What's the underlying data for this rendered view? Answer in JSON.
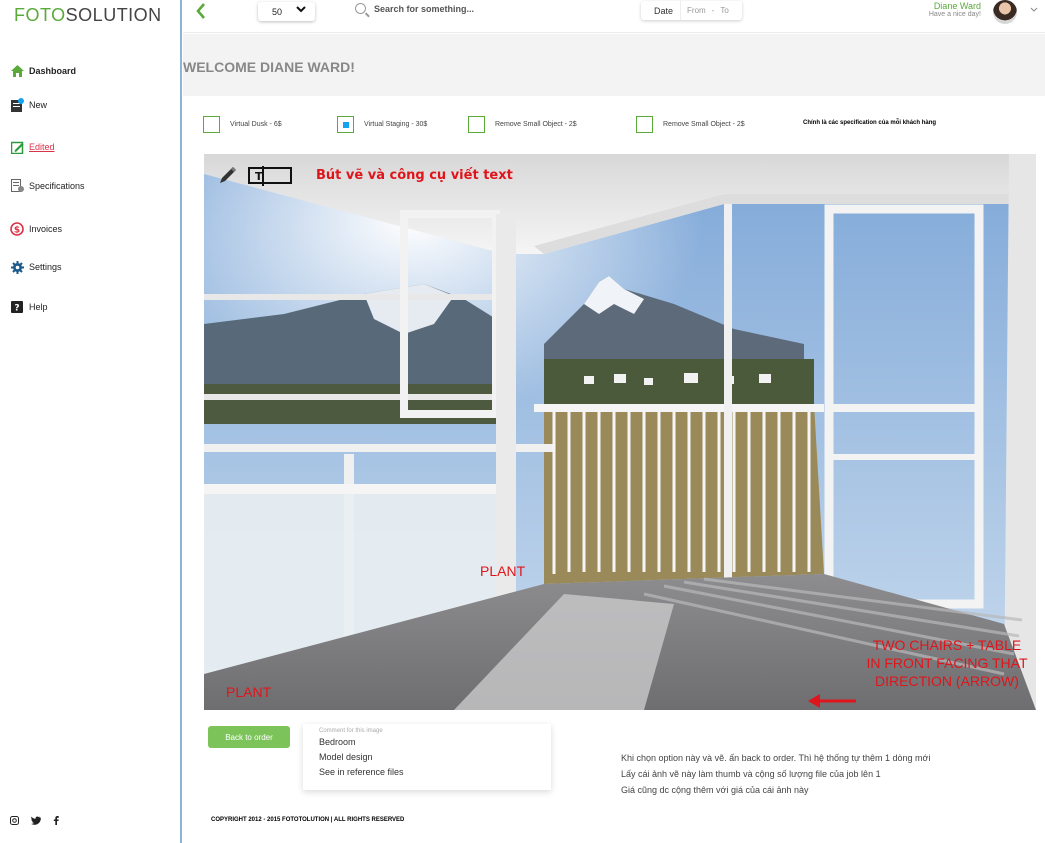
{
  "brand": {
    "part1": "FOTO",
    "part2": "SOLUTION"
  },
  "sidebar": {
    "items": [
      {
        "label": "Dashboard",
        "icon": "home-icon"
      },
      {
        "label": "New",
        "icon": "new-icon"
      },
      {
        "label": "Edited",
        "icon": "edit-icon"
      },
      {
        "label": "Specifications",
        "icon": "specifications-icon"
      },
      {
        "label": "Invoices",
        "icon": "invoices-icon"
      },
      {
        "label": "Settings",
        "icon": "gear-icon"
      },
      {
        "label": "Help",
        "icon": "help-icon"
      }
    ],
    "social": [
      "instagram-icon",
      "twitter-icon",
      "facebook-icon"
    ]
  },
  "topbar": {
    "back_icon": "chevron-left-icon",
    "page_size": "50",
    "search_placeholder": "Search for something...",
    "date_label": "Date",
    "from_label": "From",
    "dash": "-",
    "to_label": "To",
    "user_name": "Diane Ward",
    "user_greeting": "Have a nice day!"
  },
  "main": {
    "welcome": "WELCOME DIANE WARD!",
    "options": [
      {
        "label": "Virtual Dusk - 6$",
        "checked": false
      },
      {
        "label": "Virtual Staging - 30$",
        "checked": true
      },
      {
        "label": "Remove Small Object - 2$",
        "checked": false
      },
      {
        "label": "Remove Small Object - 2$",
        "checked": false
      }
    ],
    "options_note": "Chính là các specification của mỗi khách hàng",
    "toolbar_caption": "Bút vẽ và công cụ viết text",
    "annotations": {
      "plant_center": "PLANT",
      "plant_left": "PLANT",
      "chairs": "TWO CHAIRS + TABLE IN FRONT FACING THAT DIRECTION (ARROW)"
    },
    "back_button": "Back to order",
    "comment": {
      "label": "Comment for this image",
      "lines": [
        "Bedroom",
        "Model design",
        "See in reference files"
      ]
    },
    "note_lines": [
      "Khi chọn option này và vẽ. ấn back to order. Thì hệ thống tự thêm 1 dòng mới",
      "Lấy cái ảnh vẽ này làm thumb và cộng số lượng file của job lên 1",
      "Giá cũng dc cộng thêm với giá của cái ảnh này"
    ],
    "copyright": "COPYRIGHT 2012 - 2015 FOTOTOLUTION  |  ALL RIGHTS RESERVED"
  },
  "colors": {
    "brand_green": "#5aaa3a",
    "annotation_red": "#e0151b",
    "accent_blue": "#14a3f0",
    "edited_red": "#d9334a"
  }
}
